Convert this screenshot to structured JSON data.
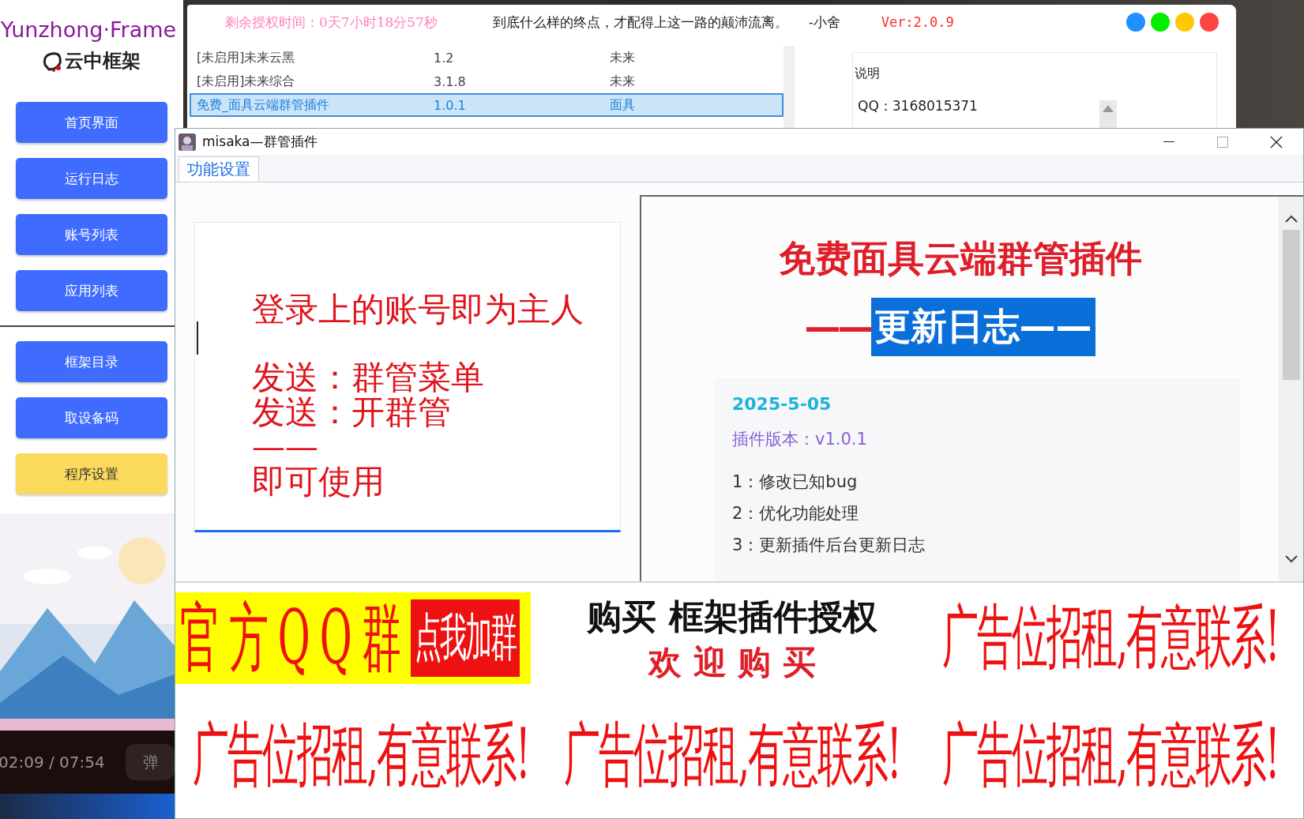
{
  "sidebar": {
    "title": "Yunzhong·Frame",
    "logo": "云中框架",
    "button_groups": [
      [
        {
          "label": "首页界面",
          "selected": false
        },
        {
          "label": "运行日志",
          "selected": false
        },
        {
          "label": "账号列表",
          "selected": false
        },
        {
          "label": "应用列表",
          "selected": false
        }
      ],
      [
        {
          "label": "框架目录",
          "selected": false
        },
        {
          "label": "取设备码",
          "selected": false
        },
        {
          "label": "程序设置",
          "selected": true
        }
      ]
    ]
  },
  "video_bar": {
    "time": "02:09 / 07:54",
    "danmaku_button": "弹"
  },
  "main_window": {
    "license_time": "剩余授权时间：0天7小时18分57秒",
    "quote": "到底什么样的终点，才配得上这一路的颠沛流离。",
    "quote_author": "-小舍",
    "version": "Ver:2.0.9",
    "window_buttons": [
      {
        "color": "#1e90ff"
      },
      {
        "color": "#00ee00"
      },
      {
        "color": "#ffc800"
      },
      {
        "color": "#ff4444"
      }
    ],
    "plugins": [
      {
        "name": "[未启用]未来云黑",
        "version": "1.2",
        "author": "未来",
        "selected": false
      },
      {
        "name": "[未启用]未来综合",
        "version": "3.1.8",
        "author": "未来",
        "selected": false
      },
      {
        "name": "免费_面具云端群管插件",
        "version": "1.0.1",
        "author": "面具",
        "selected": true
      }
    ],
    "info_panel": {
      "title": "说明",
      "qq": "QQ：3168015371"
    }
  },
  "dialog": {
    "title": "misaka—群管插件",
    "tabs": [
      {
        "label": "功能设置",
        "selected": true
      }
    ],
    "instructions": {
      "owner_line": "登录上的账号即为主人",
      "commands": [
        "发送：群管菜单",
        "发送：开群管"
      ],
      "separator": "——",
      "footer": "即可使用"
    },
    "changelog": {
      "title": "免费面具云端群管插件",
      "subtitle_prefix": "——",
      "subtitle_selected": "更新日志——",
      "date": "2025-5-05",
      "version": "插件版本：v1.0.1",
      "items": [
        "1：修改已知bug",
        "2：优化功能处理",
        "3：更新插件后台更新日志"
      ]
    },
    "ads": [
      {
        "kind": "qq_group",
        "text": "官 方 Q Q 群",
        "button": "点我加群"
      },
      {
        "kind": "purchase",
        "line_1": "购买 框架插件授权",
        "line_2": "欢 迎 购 买"
      },
      {
        "kind": "rent",
        "text": "广告位招租,有意联系!"
      },
      {
        "kind": "rent",
        "text": "广告位招租,有意联系!"
      },
      {
        "kind": "rent",
        "text": "广告位招租,有意联系!"
      },
      {
        "kind": "rent",
        "text": "广告位招租,有意联系!"
      }
    ]
  }
}
